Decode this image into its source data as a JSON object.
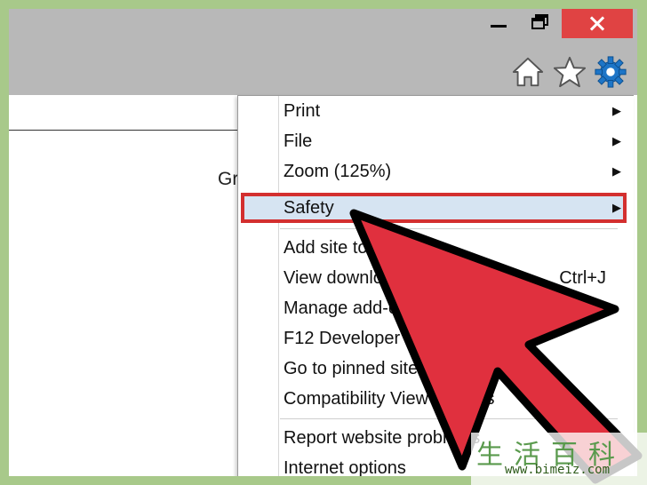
{
  "window": {
    "accent_close": "#e04343",
    "icons": [
      "minimize-icon",
      "restore-icon",
      "close-icon",
      "home-icon",
      "star-icon",
      "gear-icon"
    ]
  },
  "page": {
    "partial_text": "Gr"
  },
  "menu": {
    "items": [
      {
        "label": "Print",
        "submenu": true
      },
      {
        "label": "File",
        "submenu": true
      },
      {
        "label": "Zoom (125%)",
        "submenu": true
      },
      {
        "label": "Safety",
        "submenu": true,
        "highlighted": true
      },
      {
        "label": "Add site to Apps",
        "submenu": false
      },
      {
        "label": "View downloads",
        "shortcut": "Ctrl+J"
      },
      {
        "label": "Manage add-ons",
        "submenu": false
      },
      {
        "label": "F12 Developer tools",
        "submenu": false
      },
      {
        "label": "Go to pinned sites",
        "submenu": false
      },
      {
        "label": "Compatibility View settings",
        "submenu": false
      },
      {
        "label": "Report website problems",
        "submenu": false
      },
      {
        "label": "Internet options",
        "submenu": false
      }
    ],
    "submenu_arrow": "▶",
    "highlight_color": "#d6e4f2",
    "callout_color": "#d32f2f"
  },
  "annotation": {
    "pointer_color": "#e0303e"
  },
  "watermark": {
    "chars": "生活百科",
    "url": "www.bimeiz.com"
  }
}
